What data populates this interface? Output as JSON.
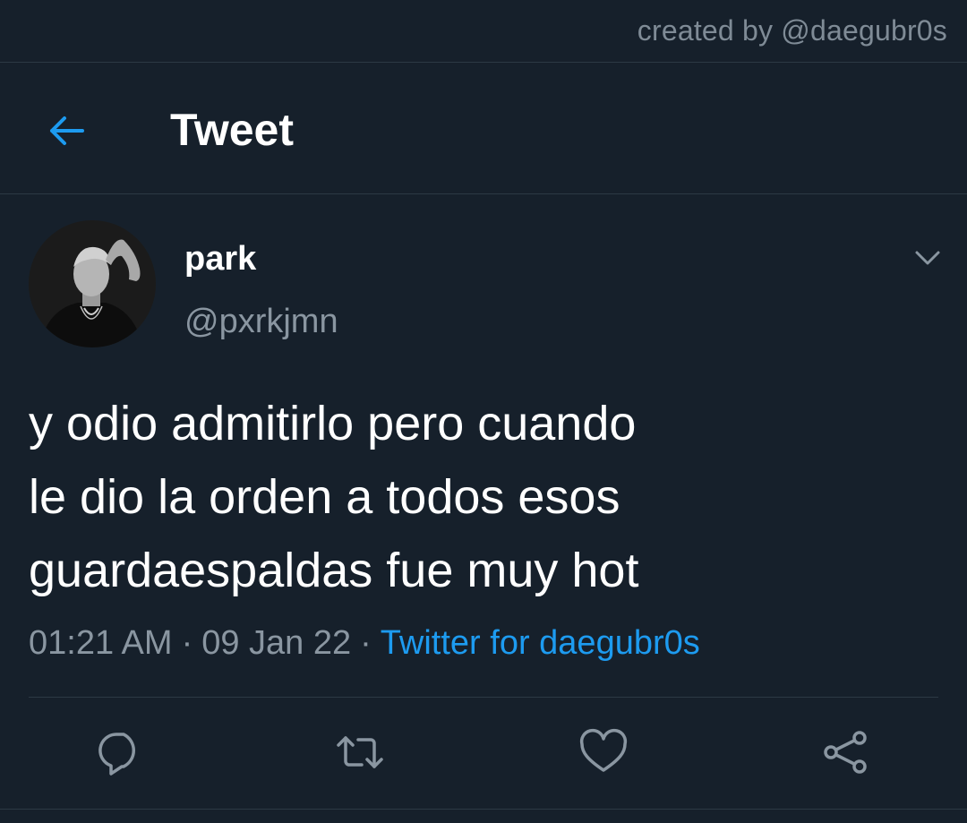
{
  "watermark": "created by @daegubr0s",
  "header": {
    "title": "Tweet"
  },
  "author": {
    "display_name": "park",
    "handle": "@pxrkjmn"
  },
  "tweet": {
    "lines": [
      "y odio admitirlo pero cuando",
      "le dio la orden a todos esos",
      "guardaespaldas fue muy hot"
    ]
  },
  "meta": {
    "time": "01:21 AM",
    "separator": "·",
    "date": "09 Jan 22",
    "source": "Twitter for daegubr0s"
  },
  "colors": {
    "background": "#16202b",
    "accent": "#1d9bf0",
    "secondary_text": "#8a96a1",
    "divider": "#2c3944"
  },
  "icons": {
    "back": "arrow-left-icon",
    "more": "chevron-down-icon",
    "reply": "reply-icon",
    "retweet": "retweet-icon",
    "like": "heart-icon",
    "share": "share-icon"
  }
}
